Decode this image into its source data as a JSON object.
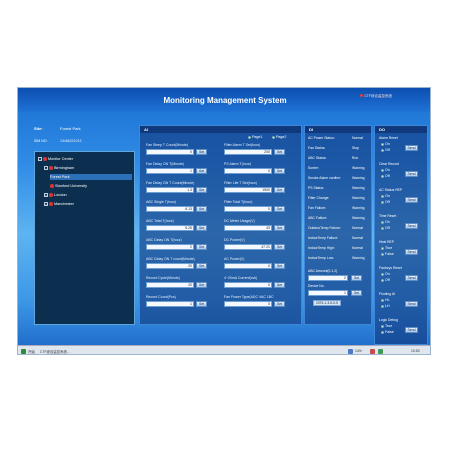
{
  "app": {
    "title": "Monitoring Management System",
    "top_right": "CTF综合监控系统",
    "site_label": "Site:",
    "site_value": "Forest Park",
    "sys_label": "SIM NO:",
    "sys_value": "13466221013"
  },
  "tree": {
    "items": [
      {
        "label": "Monitor Center",
        "level": 0,
        "expander": "-",
        "node": true
      },
      {
        "label": "Birmingham",
        "level": 1,
        "expander": "-",
        "node": true
      },
      {
        "label": "Forest Park",
        "level": 2,
        "expander": "",
        "node": false,
        "selected": true
      },
      {
        "label": "Stanford University",
        "level": 2,
        "expander": "",
        "node": true
      },
      {
        "label": "London",
        "level": 1,
        "expander": "+",
        "node": true
      },
      {
        "label": "Manchester",
        "level": 1,
        "expander": "+",
        "node": true
      }
    ]
  },
  "ai_panel": {
    "title": "AI",
    "page1": "Page1",
    "page2": "Page2",
    "set_label": "Set",
    "left": [
      {
        "label": "Fan Sleep T Count(Minute)",
        "value": "0"
      },
      {
        "label": "Fan Delay ON T(Minute)",
        "value": "1"
      },
      {
        "label": "Fan Delay ON T Count(Minute)",
        "value": "1.3"
      },
      {
        "label": "ABC Single T(hour)",
        "value": "6.13"
      },
      {
        "label": "ABC Total T(hour)",
        "value": "5.25"
      },
      {
        "label": "ABC Delay ON T(hour)",
        "value": "2"
      },
      {
        "label": "ABC Delay ON T count(Minute)",
        "value": "20"
      },
      {
        "label": "Record Cycle(Minute)",
        "value": "20"
      },
      {
        "label": "Record Count(Pcs)",
        "value": "1"
      }
    ],
    "right": [
      {
        "label": "Filter Alarm T Set(hour)",
        "value": "200"
      },
      {
        "label": "PS Alarm T(hour)",
        "value": "0"
      },
      {
        "label": "Filter Life T Set(hour)",
        "value": "1500"
      },
      {
        "label": "Filter Total T(hour)",
        "value": "0"
      },
      {
        "label": "DC Meter Usage(V)",
        "value": "43"
      },
      {
        "label": "DC Power(V)",
        "value": "47.21"
      },
      {
        "label": "AC Power(V)",
        "value": "0"
      },
      {
        "label": "4~20mA Current(mA)",
        "value": "0"
      },
      {
        "label": "Fan Power Type(ADC VAC 1BC",
        "value": "0"
      }
    ]
  },
  "di_panel": {
    "title": "DI",
    "items": [
      {
        "label": "AC Power Status:",
        "value": "Normal"
      },
      {
        "label": "Fan Status:",
        "value": "Stop"
      },
      {
        "label": "ABC Status:",
        "value": "Run"
      },
      {
        "label": "Sonter:",
        "value": "Warning"
      },
      {
        "label": "Smoke Alarm confirm:",
        "value": "Warning"
      },
      {
        "label": "PS Status:",
        "value": "Warning"
      },
      {
        "label": "Filter Change:",
        "value": "Warning"
      },
      {
        "label": "Fan Failure:",
        "value": "Warning"
      },
      {
        "label": "ABC Failure:",
        "value": "Warning"
      },
      {
        "label": "OutdoorTemp Failure:",
        "value": "Normal"
      },
      {
        "label": "IndoorTemp Failure:",
        "value": "Normal"
      },
      {
        "label": "IndoorTemp High:",
        "value": "Normal"
      },
      {
        "label": "IndoorTemp Low:",
        "value": "Warning"
      }
    ],
    "abc_amount_label": "ABC Amount(0,1,2)",
    "abc_amount_value": "2",
    "device_no_label": "Device No.",
    "device_no_value": "1",
    "ip_chip": "2076-1-3-5-0-5",
    "set_label": "Set"
  },
  "do_panel": {
    "title": "DO",
    "send_label": "Send",
    "groups": [
      {
        "title": "Alarm Reset",
        "opt1": "On",
        "opt2": "Off"
      },
      {
        "title": "Clear Record",
        "opt1": "On",
        "opt2": "Off"
      },
      {
        "title": "AC Status REP",
        "opt1": "On",
        "opt2": "Off"
      },
      {
        "title": "Time Reset",
        "opt1": "On",
        "opt2": "Off"
      },
      {
        "title": "Heat REP",
        "opt1": "True",
        "opt2": "False"
      },
      {
        "title": "Factorys Reset",
        "opt1": "On",
        "opt2": "Off"
      },
      {
        "title": "Flooting AI",
        "opt1": "HL",
        "opt2": "LH"
      },
      {
        "title": "Logic Debug",
        "opt1": "True",
        "opt2": "False"
      }
    ]
  },
  "taskbar": {
    "start_text": "开始",
    "task_text": "CTF综合监控系统...",
    "clock_text": "10:53",
    "ime_text": "14%"
  }
}
